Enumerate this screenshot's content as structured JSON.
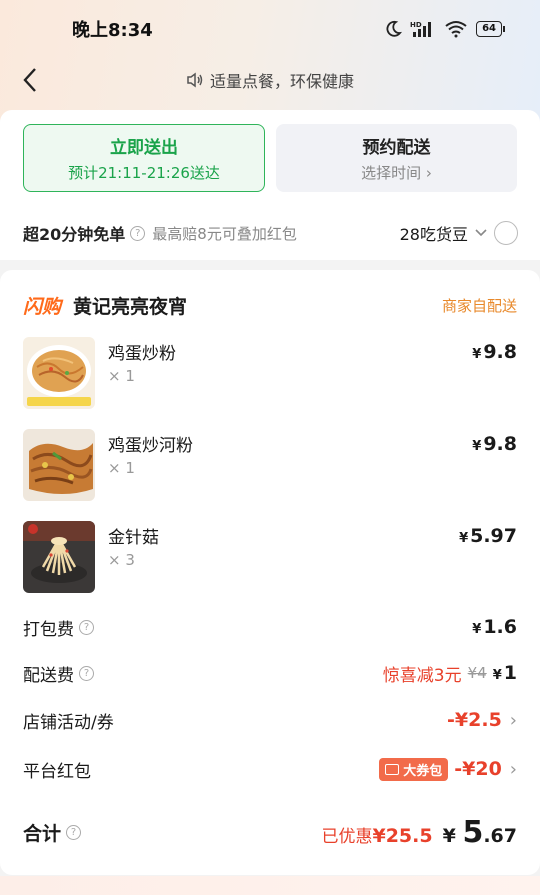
{
  "status_bar": {
    "time": "晚上8:34",
    "battery": "64"
  },
  "nav": {
    "title": "适量点餐，环保健康"
  },
  "delivery_options": {
    "now": {
      "title": "立即送出",
      "subtitle": "预计21:11-21:26送达"
    },
    "scheduled": {
      "title": "预约配送",
      "subtitle": "选择时间"
    }
  },
  "bean_row": {
    "label": "超20分钟免单",
    "desc": "最高赔8元可叠加红包",
    "bean": "28吃货豆"
  },
  "shop": {
    "flash": "闪购",
    "name": "黄记亮亮夜宵",
    "delivery": "商家自配送"
  },
  "items": [
    {
      "name": "鸡蛋炒粉",
      "qty": "× 1",
      "price": "9.8"
    },
    {
      "name": "鸡蛋炒河粉",
      "qty": "× 1",
      "price": "9.8"
    },
    {
      "name": "金针菇",
      "qty": "× 3",
      "price": "5.97"
    }
  ],
  "fees": {
    "packing": {
      "label": "打包费",
      "value": "1.6"
    },
    "delivery": {
      "label": "配送费",
      "promo": "惊喜减3元",
      "original": "¥4",
      "value": "1"
    },
    "shop_promo": {
      "label": "店铺活动/券",
      "value": "-¥2.5"
    },
    "platform_coupon": {
      "label": "平台红包",
      "badge": "大券包",
      "value": "-¥20"
    }
  },
  "total": {
    "label": "合计",
    "saved_prefix": "已优惠",
    "saved_value": "¥25.5",
    "price_int": "5",
    "price_dec": ".67",
    "currency": "¥"
  },
  "colors": {
    "accent_green": "#1aa34a",
    "accent_red": "#e8412b",
    "accent_orange": "#ff6a1a"
  }
}
